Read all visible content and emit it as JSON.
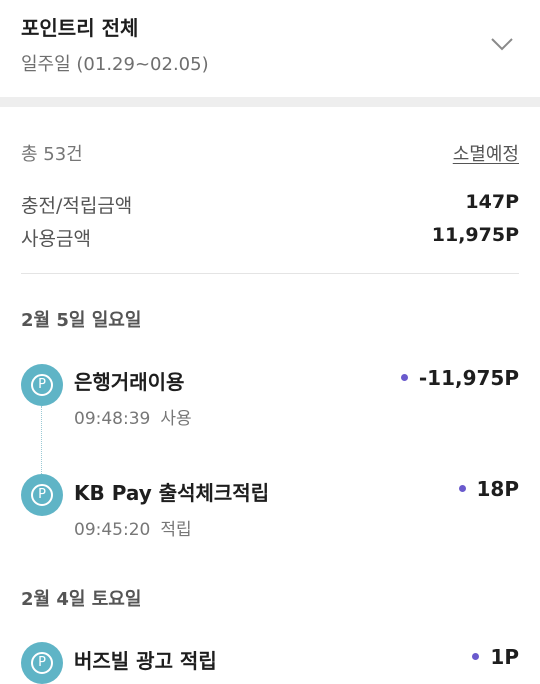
{
  "header": {
    "title": "포인트리 전체",
    "period": "일주일 (01.29~02.05)"
  },
  "summary": {
    "total_count": "총 53건",
    "expire_link": "소멸예정",
    "earned_label": "충전/적립금액",
    "earned_value": "147P",
    "used_label": "사용금액",
    "used_value": "11,975P"
  },
  "groups": [
    {
      "date": "2월 5일 일요일",
      "items": [
        {
          "name": "은행거래이용",
          "time": "09:48:39",
          "type": "사용",
          "amount": "-11,975P"
        },
        {
          "name": "KB Pay 출석체크적립",
          "time": "09:45:20",
          "type": "적립",
          "amount": "18P"
        }
      ]
    },
    {
      "date": "2월 4일 토요일",
      "items": [
        {
          "name": "버즈빌 광고 적립",
          "amount": "1P"
        }
      ]
    }
  ],
  "icons": {
    "point": "P",
    "accent": "#5fb4c6",
    "dot": "#6a5acd"
  }
}
